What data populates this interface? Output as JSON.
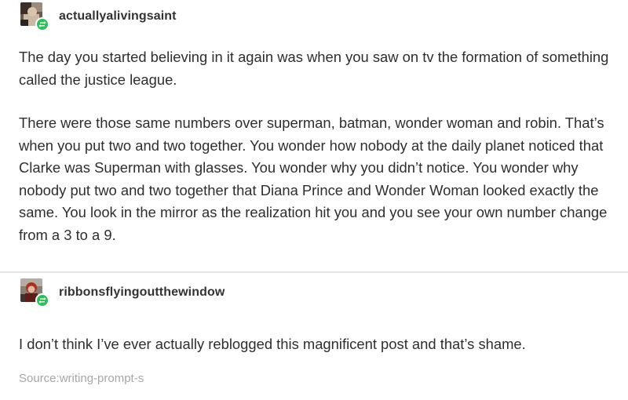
{
  "posts": [
    {
      "username": "actuallyalivingsaint",
      "paragraphs": [
        "The day you started believing in it again was when you saw on tv the formation of something called the justice league.",
        "There were those same numbers over superman, batman, wonder woman and robin. That’s when you put two and two together. You wonder how nobody at the daily planet noticed that Clarke was Superman with glasses. You wonder why you didn’t notice. You wonder why nobody put two and two together that Diana Prince and Wonder Woman looked exactly the same. You look in the mirror as the realization hit you and you see your own number change from a 3 to a 9."
      ]
    },
    {
      "username": "ribbonsflyingoutthewindow",
      "paragraphs": [
        "I don’t think I’ve ever actually reblogged this magnificent post and that’s shame."
      ],
      "source": "Source:writing-prompt-s"
    }
  ],
  "colors": {
    "reblog_badge": "#2fbf5a",
    "divider": "#e4e4e4",
    "source_text": "#a6a6a6"
  },
  "icons": {
    "reblog": "reblog-icon"
  }
}
